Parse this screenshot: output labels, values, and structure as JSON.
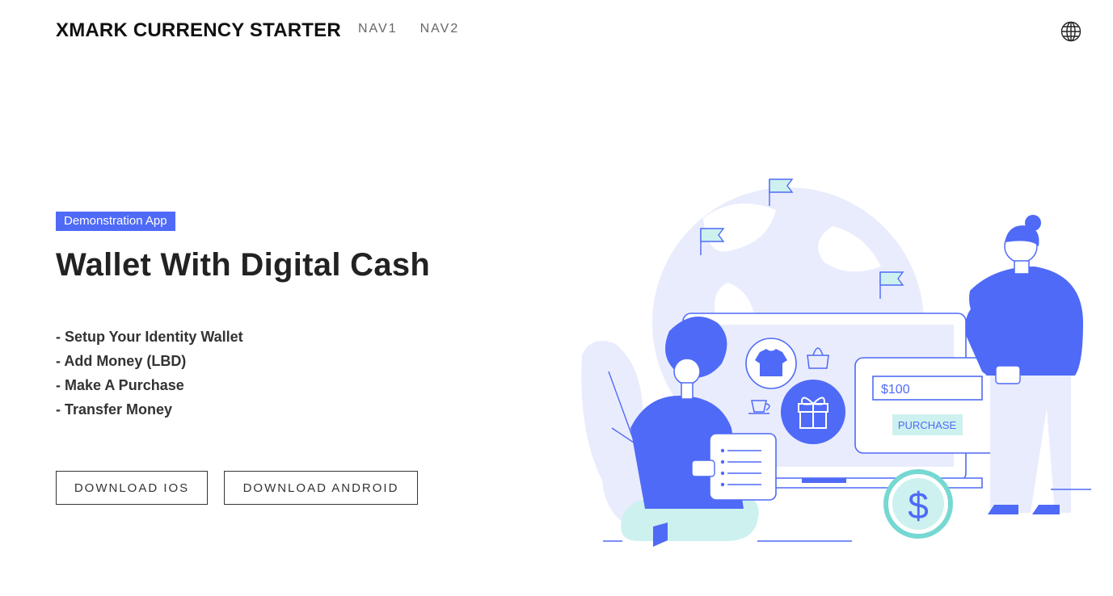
{
  "header": {
    "brand": "XMARK CURRENCY STARTER",
    "nav": [
      "NAV1",
      "NAV2"
    ],
    "language_icon": "globe-icon"
  },
  "hero": {
    "badge": "Demonstration App",
    "title": "Wallet With Digital Cash",
    "features": [
      "- Setup Your Identity Wallet",
      "- Add Money (LBD)",
      "- Make A Purchase",
      "- Transfer Money"
    ],
    "buttons": {
      "ios": "DOWNLOAD IOS",
      "android": "DOWNLOAD ANDROID"
    }
  },
  "illustration": {
    "amount": "$100",
    "purchase": "PURCHASE",
    "coin_symbol": "$"
  },
  "colors": {
    "accent": "#4f6af7",
    "light_blue": "#e9ecfd",
    "mint": "#cdf1ee",
    "teal": "#76d8d2"
  }
}
